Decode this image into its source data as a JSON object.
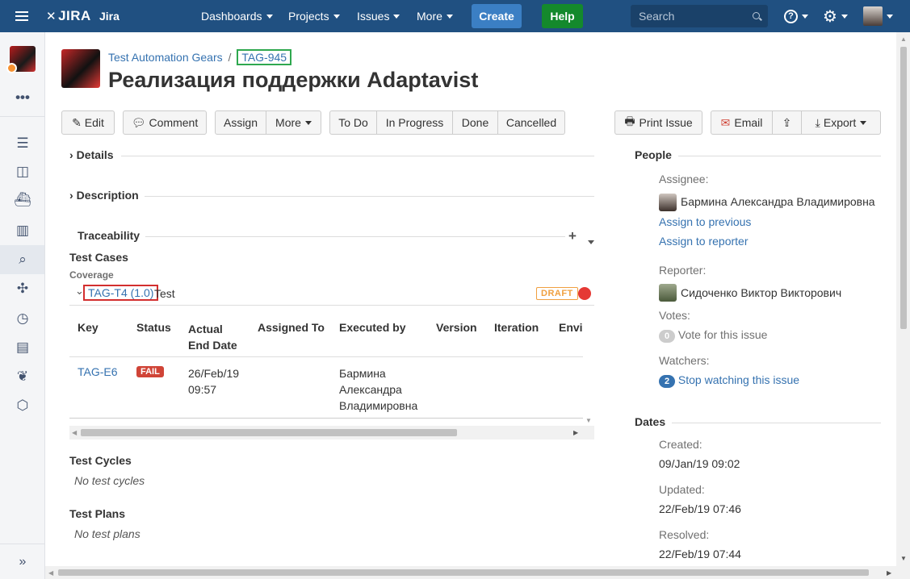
{
  "topbar": {
    "logo": "JIRA",
    "app_name": "Jira",
    "menu": [
      "Dashboards",
      "Projects",
      "Issues",
      "More"
    ],
    "create_label": "Create",
    "help_label": "Help",
    "search_placeholder": "Search",
    "colors": {
      "bar": "#205081",
      "create": "#3b7fc4",
      "help": "#14892c"
    }
  },
  "sidebar": {
    "icons": [
      "project-avatar",
      "more-dots",
      "backlog-icon",
      "board-icon",
      "releases-icon",
      "reports-icon",
      "test-search-icon",
      "components-icon",
      "tests-icon",
      "test-cycles-icon",
      "test-plans-icon",
      "settings-icon",
      "expand-sidebar-icon"
    ]
  },
  "breadcrumb": {
    "project": "Test Automation Gears",
    "separator": "/",
    "issue_key": "TAG-945"
  },
  "issue": {
    "title": "Реализация поддержки Adaptavist"
  },
  "toolbar": {
    "edit": "Edit",
    "comment": "Comment",
    "assign": "Assign",
    "more": "More",
    "todo": "To Do",
    "in_progress": "In Progress",
    "done": "Done",
    "cancelled": "Cancelled",
    "print": "Print Issue",
    "email": "Email",
    "export": "Export"
  },
  "sections": {
    "details": "Details",
    "description": "Description",
    "traceability": "Traceability"
  },
  "test_cases": {
    "heading": "Test Cases",
    "coverage_label": "Coverage",
    "case_key": "TAG-T4 (1.0)",
    "case_name": "Test",
    "case_status": "DRAFT",
    "columns": [
      "Key",
      "Status",
      "Actual End Date",
      "Assigned To",
      "Executed by",
      "Version",
      "Iteration",
      "Envi"
    ],
    "row": {
      "key": "TAG-E6",
      "status": "FAIL",
      "date_line1": "26/Feb/19",
      "date_line2": "09:57",
      "assigned_to": "",
      "executed_line1": "Бармина",
      "executed_line2": "Александра",
      "executed_line3": "Владимировна"
    }
  },
  "test_cycles": {
    "heading": "Test Cycles",
    "empty": "No test cycles"
  },
  "test_plans": {
    "heading": "Test Plans",
    "empty": "No test plans"
  },
  "people": {
    "heading": "People",
    "assignee_label": "Assignee:",
    "assignee_name": "Бармина Александра Владимировна",
    "assign_previous": "Assign to previous",
    "assign_reporter": "Assign to reporter",
    "reporter_label": "Reporter:",
    "reporter_name": "Сидоченко Виктор Викторович",
    "votes_label": "Votes:",
    "votes_count": "0",
    "vote_action": "Vote for this issue",
    "watchers_label": "Watchers:",
    "watchers_count": "2",
    "watch_action": "Stop watching this issue"
  },
  "dates": {
    "heading": "Dates",
    "created_label": "Created:",
    "created": "09/Jan/19 09:02",
    "updated_label": "Updated:",
    "updated": "22/Feb/19 07:46",
    "resolved_label": "Resolved:",
    "resolved": "22/Feb/19 07:44"
  }
}
